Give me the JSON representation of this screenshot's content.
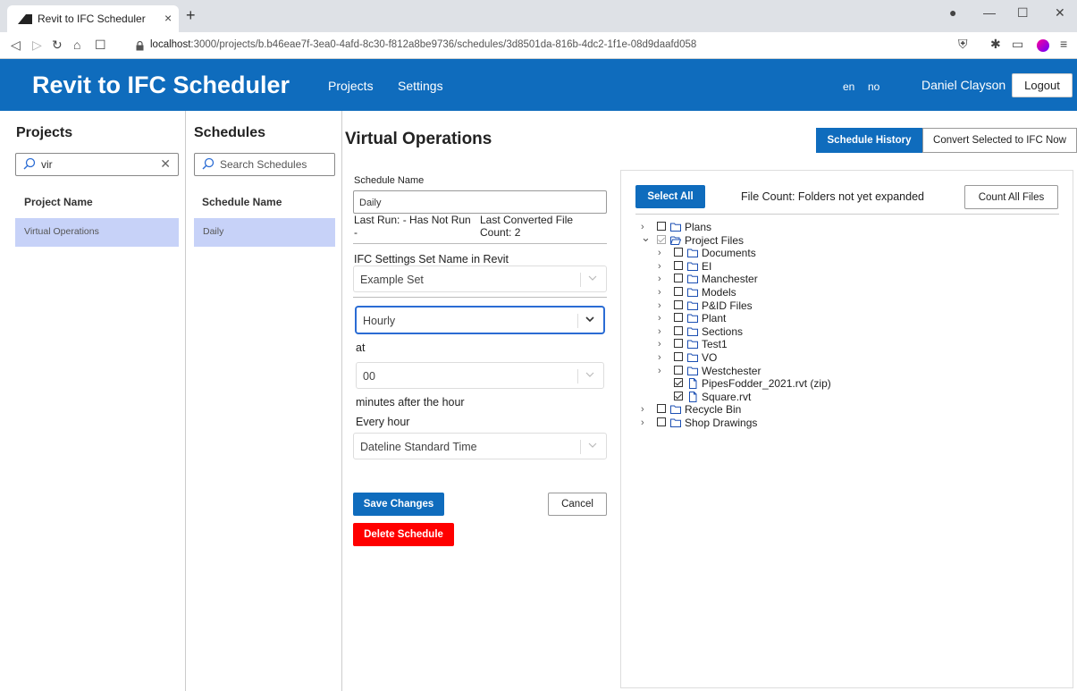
{
  "browser": {
    "tab_title": "Revit to IFC Scheduler",
    "tab_close": "×",
    "new_tab": "+",
    "url_host": "localhost",
    "url_rest": ":3000/projects/b.b46eae7f-3ea0-4afd-8c30-f812a8be9736/schedules/3d8501da-816b-4dc2-1f1e-08d9daafd058"
  },
  "header": {
    "brand": "Revit to IFC Scheduler",
    "nav": [
      "Projects",
      "Settings"
    ],
    "languages": [
      "en",
      "no"
    ],
    "user": "Daniel Clayson",
    "logout": "Logout"
  },
  "projects": {
    "heading": "Projects",
    "search_value": "vir",
    "column_header": "Project Name",
    "items": [
      "Virtual Operations"
    ]
  },
  "schedules": {
    "heading": "Schedules",
    "search_placeholder": "Search Schedules",
    "column_header": "Schedule Name",
    "items": [
      "Daily"
    ]
  },
  "main": {
    "title": "Virtual Operations",
    "schedule_history": "Schedule History",
    "convert_now": "Convert Selected to IFC Now"
  },
  "form": {
    "schedule_name_label": "Schedule Name",
    "schedule_name_value": "Daily",
    "last_run": "Last Run: - Has Not Run",
    "last_run_dash": "-",
    "last_converted_line1": "Last Converted File",
    "last_converted_line2": "Count: 2",
    "ifc_label": "IFC Settings Set Name in Revit",
    "ifc_value": "Example Set",
    "frequency": "Hourly",
    "at_label": "at",
    "minute_value": "00",
    "minutes_label": "minutes after the hour",
    "every_hour": "Every hour",
    "timezone": "Dateline Standard Time",
    "save": "Save Changes",
    "cancel": "Cancel",
    "delete": "Delete Schedule"
  },
  "files": {
    "select_all": "Select All",
    "count_status": "File Count: Folders not yet expanded",
    "count_all": "Count All Files",
    "tree": [
      {
        "name": "Plans",
        "level": 0,
        "type": "folder",
        "checked": false,
        "expandable": true,
        "expanded": false
      },
      {
        "name": "Project Files",
        "level": 0,
        "type": "folder",
        "checked": true,
        "dim": true,
        "expandable": true,
        "expanded": true
      },
      {
        "name": "Documents",
        "level": 1,
        "type": "folder",
        "checked": false,
        "expandable": true,
        "expanded": false
      },
      {
        "name": "EI",
        "level": 1,
        "type": "folder",
        "checked": false,
        "expandable": true,
        "expanded": false
      },
      {
        "name": "Manchester",
        "level": 1,
        "type": "folder",
        "checked": false,
        "expandable": true,
        "expanded": false
      },
      {
        "name": "Models",
        "level": 1,
        "type": "folder",
        "checked": false,
        "expandable": true,
        "expanded": false
      },
      {
        "name": "P&ID Files",
        "level": 1,
        "type": "folder",
        "checked": false,
        "expandable": true,
        "expanded": false
      },
      {
        "name": "Plant",
        "level": 1,
        "type": "folder",
        "checked": false,
        "expandable": true,
        "expanded": false
      },
      {
        "name": "Sections",
        "level": 1,
        "type": "folder",
        "checked": false,
        "expandable": true,
        "expanded": false
      },
      {
        "name": "Test1",
        "level": 1,
        "type": "folder",
        "checked": false,
        "expandable": true,
        "expanded": false
      },
      {
        "name": "VO",
        "level": 1,
        "type": "folder",
        "checked": false,
        "expandable": true,
        "expanded": false
      },
      {
        "name": "Westchester",
        "level": 1,
        "type": "folder",
        "checked": false,
        "expandable": true,
        "expanded": false
      },
      {
        "name": "PipesFodder_2021.rvt (zip)",
        "level": 1,
        "type": "file",
        "checked": true,
        "expandable": false
      },
      {
        "name": "Square.rvt",
        "level": 1,
        "type": "file",
        "checked": true,
        "expandable": false
      },
      {
        "name": "Recycle Bin",
        "level": 0,
        "type": "folder",
        "checked": false,
        "expandable": true,
        "expanded": false
      },
      {
        "name": "Shop Drawings",
        "level": 0,
        "type": "folder",
        "checked": false,
        "expandable": true,
        "expanded": false
      }
    ]
  },
  "colors": {
    "primary": "#0f6cbd",
    "danger": "#ff0000",
    "selected_row": "#c7d2f8",
    "folder_icon": "#1b4fb3"
  },
  "icons": [
    "search-icon",
    "clear-icon",
    "chevron-down-icon",
    "chevron-right-icon",
    "folder-icon",
    "folder-open-icon",
    "file-icon",
    "lock-icon"
  ]
}
